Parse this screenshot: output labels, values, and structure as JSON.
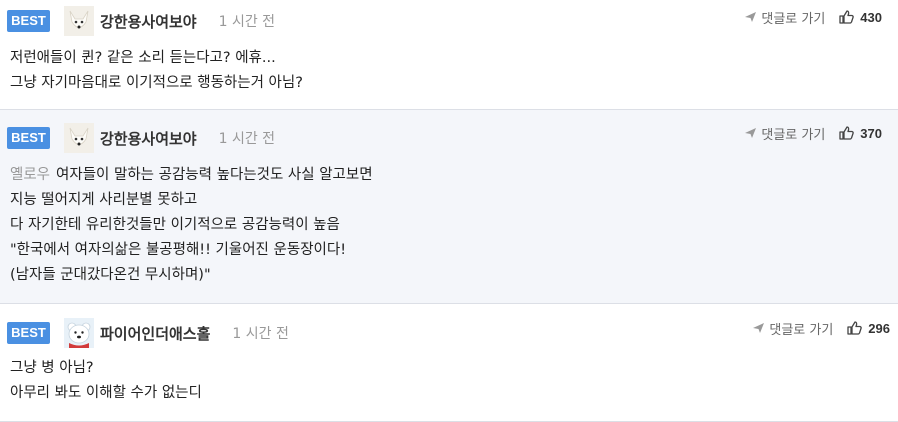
{
  "comments": [
    {
      "badge": "BEST",
      "avatar": "white-fox-avatar",
      "nickname": "강한용사여보야",
      "time": "1 시간 전",
      "reply_label": "댓글로 가기",
      "likes": "430",
      "mention": "",
      "lines": [
        "저런애들이 퀸? 같은 소리 듣는다고? 에휴...",
        "그냥 자기마음대로 이기적으로 행동하는거 아님?"
      ]
    },
    {
      "badge": "BEST",
      "avatar": "white-fox-avatar",
      "nickname": "강한용사여보야",
      "time": "1 시간 전",
      "reply_label": "댓글로 가기",
      "likes": "370",
      "mention": "옐로우",
      "lines": [
        "여자들이 말하는 공감능력 높다는것도 사실 알고보면",
        "지능 떨어지게 사리분별 못하고",
        "다 자기한테 유리한것들만 이기적으로 공감능력이 높음",
        "\"한국에서 여자의삶은 불공평해!! 기울어진 운동장이다!",
        "(남자들 군대갔다온건 무시하며)\""
      ]
    },
    {
      "badge": "BEST",
      "avatar": "polar-bear-avatar",
      "nickname": "파이어인더애스홀",
      "time": "1 시간 전",
      "reply_label": "댓글로 가기",
      "likes": "296",
      "mention": "",
      "lines": [
        "그냥 병 아님?",
        "아무리 봐도 이해할 수가 없는디"
      ]
    }
  ],
  "colors": {
    "badge": "#4a90e2",
    "alt_bg": "#f4f6fa",
    "divider": "#dcdfe6",
    "mention": "#999999"
  }
}
